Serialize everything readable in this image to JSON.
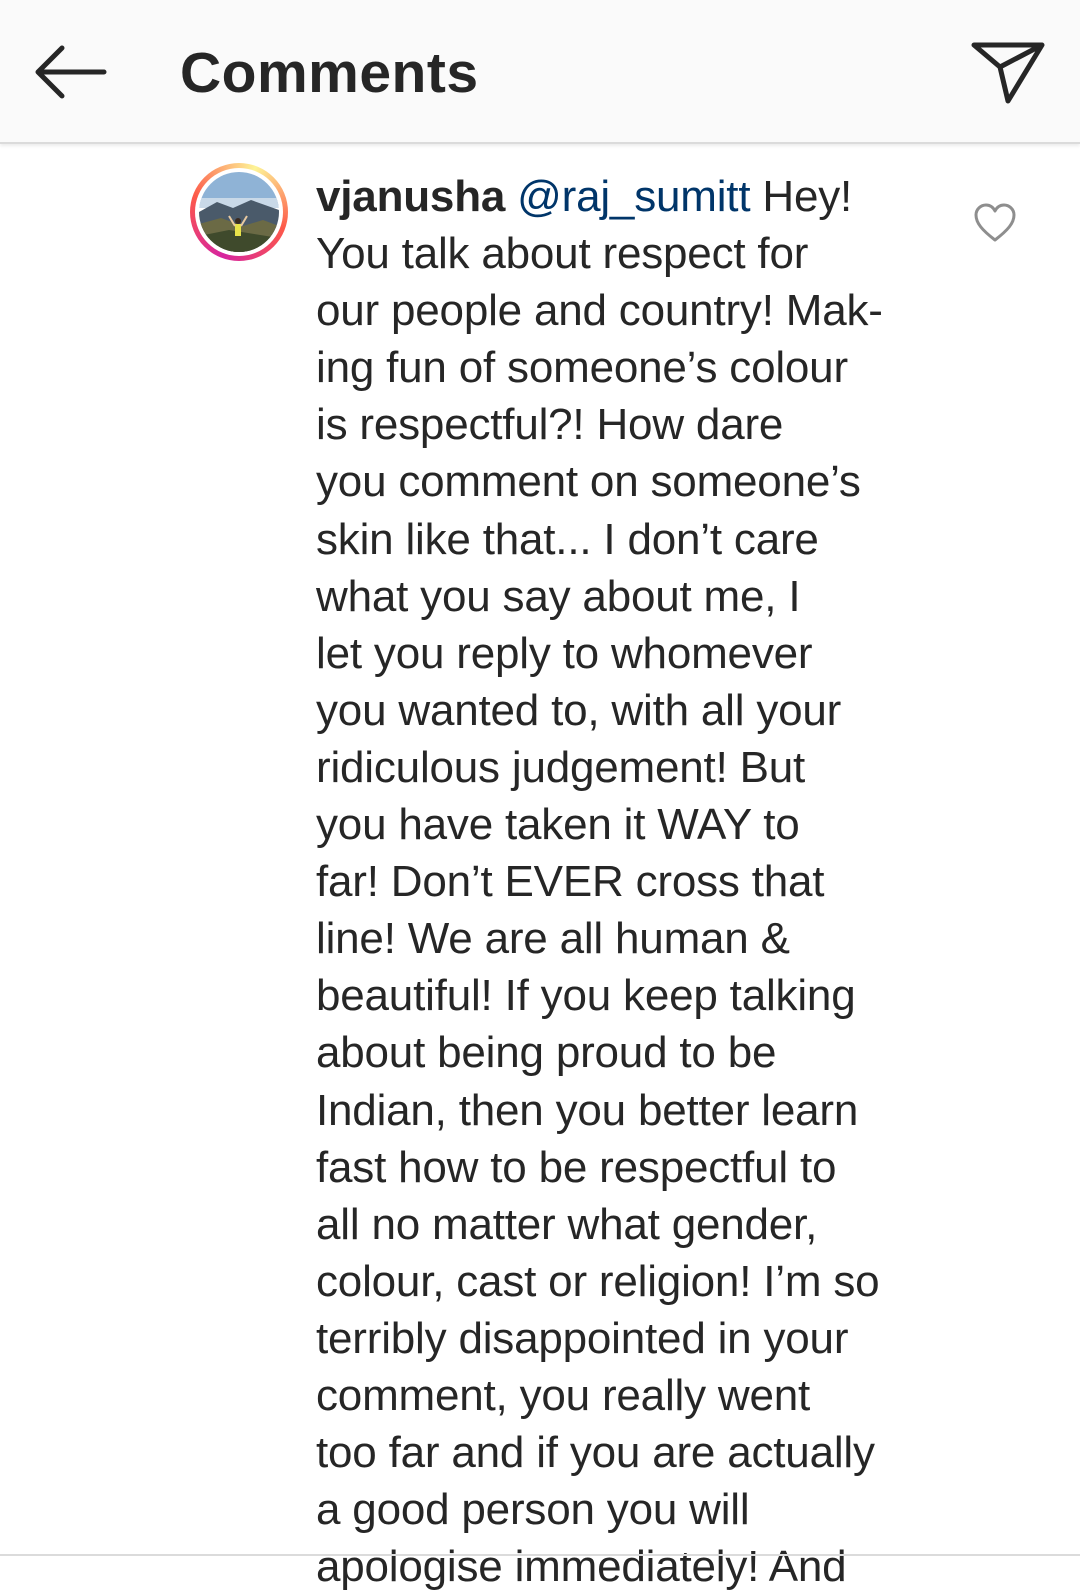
{
  "header": {
    "title": "Comments",
    "back_icon": "arrow-left-icon",
    "share_icon": "paper-plane-icon"
  },
  "comment": {
    "username": "vjanusha",
    "mention": "@raj_sumitt",
    "text_lines": [
      " Hey!",
      "You talk about respect for",
      "our people and country! Mak-",
      "ing fun of someone’s colour",
      "is respectful?! How dare",
      "you comment on someone’s",
      "skin like that... I don’t care",
      "what you say about me, I",
      "let you reply to whomever",
      "you wanted to, with all your",
      "ridiculous judgement! But",
      "you have taken it WAY to",
      "far! Don’t EVER cross that",
      "line! We are all human &",
      "beautiful! If you keep talking",
      "about being proud to be",
      "Indian, then you better learn",
      "fast how to be respectful to",
      "all no matter what gender,",
      "colour, cast or religion! I’m so",
      "terribly disappointed in your",
      "comment, you really went",
      "too far and if you are actually",
      "a good person you will",
      "apologise immediately! And"
    ],
    "like_icon": "heart-outline-icon",
    "avatar_icon": "profile-story-avatar"
  },
  "colors": {
    "header_bg": "#fafafa",
    "text": "#262626",
    "mention": "#003569",
    "divider": "#dbdbdb"
  }
}
